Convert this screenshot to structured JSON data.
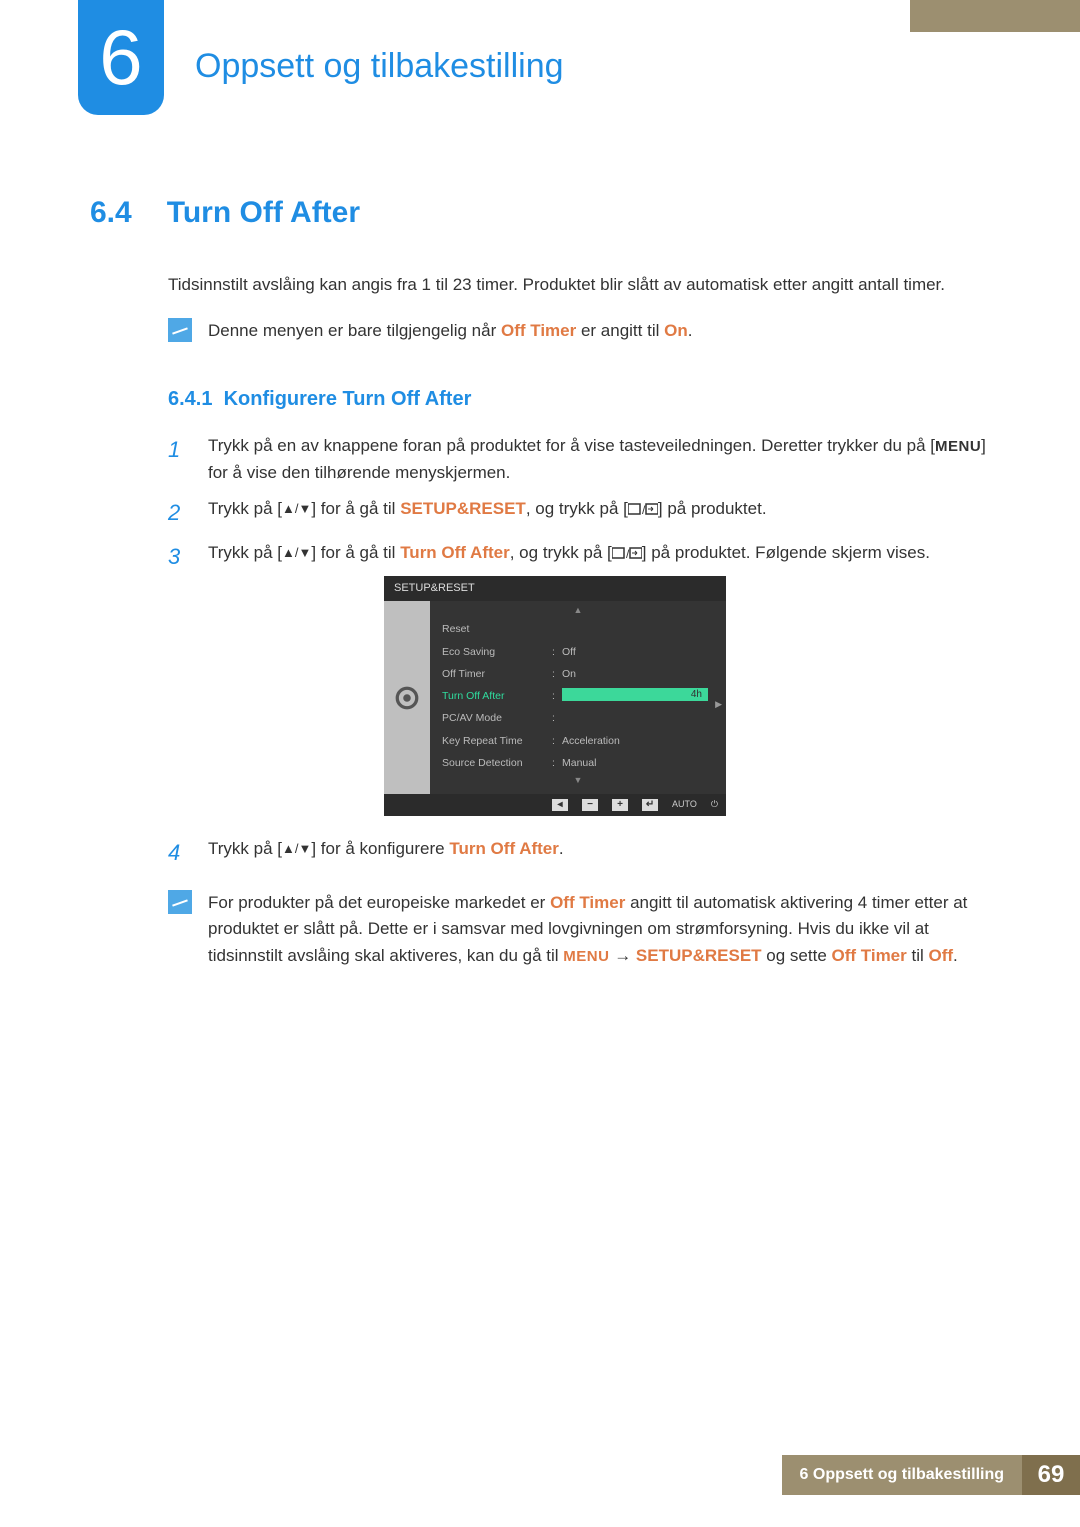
{
  "chapter": {
    "number": "6",
    "title": "Oppsett og tilbakestilling"
  },
  "section": {
    "number": "6.4",
    "title": "Turn Off After",
    "intro": "Tidsinnstilt avslåing kan angis fra 1 til 23 timer. Produktet blir slått av automatisk etter angitt antall timer."
  },
  "note1": {
    "pre": "Denne menyen er bare tilgjengelig når ",
    "hl1": "Off Timer",
    "mid": " er angitt til ",
    "hl2": "On",
    "post": "."
  },
  "subsection": {
    "number": "6.4.1",
    "title": "Konfigurere Turn Off After"
  },
  "steps": {
    "s1a": "Trykk på en av knappene foran på produktet for å vise tasteveiledningen. Deretter trykker du på [",
    "s1menu": "MENU",
    "s1b": "] for å vise den tilhørende menyskjermen.",
    "s2a": "Trykk på [",
    "s2b": "] for å gå til ",
    "s2hl": "SETUP&RESET",
    "s2c": ", og trykk på [",
    "s2d": "] på produktet.",
    "s3a": "Trykk på [",
    "s3b": "] for å gå til ",
    "s3hl": "Turn Off After",
    "s3c": ", og trykk på [",
    "s3d": "] på produktet. Følgende skjerm vises.",
    "s4a": "Trykk på [",
    "s4b": "] for å konfigurere ",
    "s4hl": "Turn Off After",
    "s4c": "."
  },
  "osd": {
    "header": "SETUP&RESET",
    "rows": [
      {
        "label": "Reset",
        "value": ""
      },
      {
        "label": "Eco Saving",
        "value": "Off"
      },
      {
        "label": "Off Timer",
        "value": "On"
      },
      {
        "label": "Turn Off After",
        "value": "4h",
        "hl": true
      },
      {
        "label": "PC/AV Mode",
        "value": ""
      },
      {
        "label": "Key Repeat Time",
        "value": "Acceleration"
      },
      {
        "label": "Source Detection",
        "value": "Manual"
      }
    ],
    "auto": "AUTO"
  },
  "note2": {
    "t1": "For produkter på det europeiske markedet er ",
    "hl1": "Off Timer",
    "t2": " angitt til automatisk aktivering 4 timer etter at produktet er slått på. Dette er i samsvar med lovgivningen om strømforsyning. Hvis du ikke vil at tidsinnstilt avslåing skal aktiveres, kan du gå til ",
    "hl2": "MENU",
    "arrow": " → ",
    "hl3": "SETUP&RESET",
    "t3": " og sette ",
    "hl4": "Off Timer",
    "t4": " til ",
    "hl5": "Off",
    "t5": "."
  },
  "footer": {
    "left": "6 Oppsett og tilbakestilling",
    "page": "69"
  }
}
